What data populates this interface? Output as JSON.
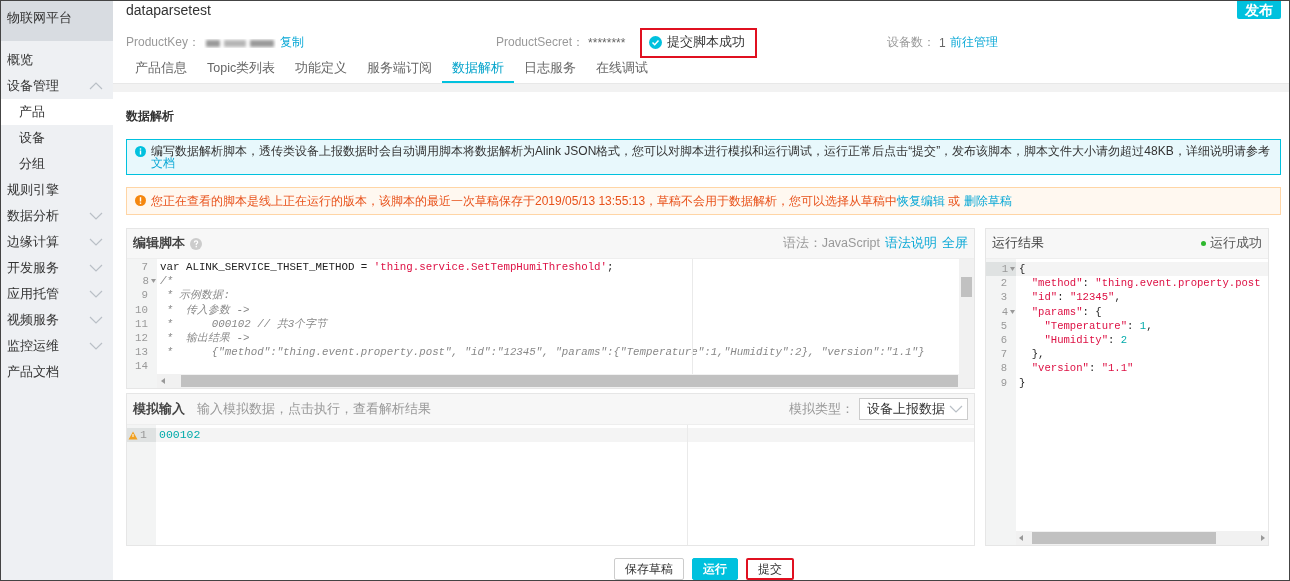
{
  "sidebar": {
    "title": "物联网平台",
    "items": [
      {
        "label": "概览",
        "kind": "link",
        "selected": false
      },
      {
        "label": "设备管理",
        "kind": "group",
        "expanded": true,
        "selected": false,
        "children": [
          {
            "label": "产品",
            "selected": true
          },
          {
            "label": "设备",
            "selected": false
          },
          {
            "label": "分组",
            "selected": false
          }
        ]
      },
      {
        "label": "规则引擎",
        "kind": "link",
        "selected": false
      },
      {
        "label": "数据分析",
        "kind": "group",
        "expanded": false,
        "selected": false
      },
      {
        "label": "边缘计算",
        "kind": "group",
        "expanded": false,
        "selected": false
      },
      {
        "label": "开发服务",
        "kind": "group",
        "expanded": false,
        "selected": false
      },
      {
        "label": "应用托管",
        "kind": "group",
        "expanded": false,
        "selected": false
      },
      {
        "label": "视频服务",
        "kind": "group",
        "expanded": false,
        "selected": false
      },
      {
        "label": "监控运维",
        "kind": "group",
        "expanded": false,
        "selected": false
      },
      {
        "label": "产品文档",
        "kind": "link",
        "selected": false
      }
    ]
  },
  "header": {
    "title": "dataparsetest",
    "publish_button": "发布",
    "product_key": {
      "label": "ProductKey：",
      "copy_link": "复制"
    },
    "product_secret": {
      "label": "ProductSecret：",
      "value": "********"
    },
    "toast": {
      "text": "提交脚本成功",
      "highlighted": true
    },
    "device_count": {
      "label": "设备数：",
      "value": "1",
      "link": "前往管理"
    },
    "tabs": [
      {
        "label": "产品信息",
        "selected": false
      },
      {
        "label": "Topic类列表",
        "selected": false
      },
      {
        "label": "功能定义",
        "selected": false
      },
      {
        "label": "服务端订阅",
        "selected": false
      },
      {
        "label": "数据解析",
        "selected": true
      },
      {
        "label": "日志服务",
        "selected": false
      },
      {
        "label": "在线调试",
        "selected": false
      }
    ]
  },
  "section_title": "数据解析",
  "info_alert": {
    "text": "编写数据解析脚本，透传类设备上报数据时会自动调用脚本将数据解析为Alink JSON格式，您可以对脚本进行模拟和运行调试，运行正常后点击“提交”，发布该脚本，脚本文件大小请勿超过48KB，详细说明请参考",
    "link": "文档"
  },
  "warning_alert": {
    "text": "您正在查看的脚本是线上正在运行的版本，该脚本的最近一次草稿保存于2019/05/13 13:55:13，草稿不会用于数据解析，您可以选择从草稿中",
    "link": "恢复编辑",
    "separator": "或",
    "link2": "删除草稿"
  },
  "script_editor": {
    "title": "编辑脚本",
    "syntax_label": "语法：JavaScript",
    "syntax_link": "语法说明",
    "fullscreen_link": "全屏",
    "lines": [
      {
        "number": "7",
        "foldable": false,
        "tokens": [
          {
            "kind": "plain",
            "text": "var ALINK_SERVICE_THSET_METHOD = "
          },
          {
            "kind": "string",
            "text": "'thing.service.SetTempHumiThreshold'"
          },
          {
            "kind": "plain",
            "text": ";"
          }
        ]
      },
      {
        "number": "8",
        "foldable": true,
        "tokens": [
          {
            "kind": "comment",
            "text": "/*"
          }
        ]
      },
      {
        "number": "9",
        "foldable": false,
        "tokens": [
          {
            "kind": "comment",
            "text": " * 示例数据:"
          }
        ]
      },
      {
        "number": "10",
        "foldable": false,
        "tokens": [
          {
            "kind": "comment",
            "text": " *  传入参数 ->"
          }
        ]
      },
      {
        "number": "11",
        "foldable": false,
        "tokens": [
          {
            "kind": "comment",
            "text": " *      000102 // 共3个字节"
          }
        ]
      },
      {
        "number": "12",
        "foldable": false,
        "tokens": [
          {
            "kind": "comment",
            "text": " *  输出结果 ->"
          }
        ]
      },
      {
        "number": "13",
        "foldable": false,
        "tokens": [
          {
            "kind": "comment",
            "text": " *      {\"method\":\"thing.event.property.post\", \"id\":\"12345\", \"params\":{\"Temperature\":1,\"Humidity\":2}, \"version\":\"1.1\"}"
          }
        ]
      },
      {
        "number": "14",
        "foldable": false
      }
    ]
  },
  "sim_input": {
    "title": "模拟输入",
    "hint": "输入模拟数据，点击执行，查看解析结果",
    "type_label": "模拟类型：",
    "type_value": "设备上报数据",
    "lines": [
      {
        "number": "1",
        "warning": true,
        "active": true,
        "tokens": [
          {
            "kind": "number",
            "text": "000102"
          }
        ]
      }
    ]
  },
  "result": {
    "title": "运行结果",
    "status": "运行成功",
    "lines": [
      {
        "number": "1",
        "foldable": true,
        "active": true,
        "tokens": [
          {
            "kind": "plain",
            "text": "{"
          }
        ]
      },
      {
        "number": "2",
        "foldable": false,
        "active": false,
        "tokens": [
          {
            "kind": "string",
            "text": "  \"method\""
          },
          {
            "kind": "plain",
            "text": ": "
          },
          {
            "kind": "string",
            "text": "\"thing.event.property.post"
          }
        ]
      },
      {
        "number": "3",
        "foldable": false,
        "active": false,
        "tokens": [
          {
            "kind": "string",
            "text": "  \"id\""
          },
          {
            "kind": "plain",
            "text": ": "
          },
          {
            "kind": "string",
            "text": "\"12345\""
          },
          {
            "kind": "plain",
            "text": ","
          }
        ]
      },
      {
        "number": "4",
        "foldable": true,
        "active": false,
        "tokens": [
          {
            "kind": "string",
            "text": "  \"params\""
          },
          {
            "kind": "plain",
            "text": ": {"
          }
        ]
      },
      {
        "number": "5",
        "foldable": false,
        "active": false,
        "tokens": [
          {
            "kind": "string",
            "text": "    \"Temperature\""
          },
          {
            "kind": "plain",
            "text": ": "
          },
          {
            "kind": "number",
            "text": "1"
          },
          {
            "kind": "plain",
            "text": ","
          }
        ]
      },
      {
        "number": "6",
        "foldable": false,
        "active": false,
        "tokens": [
          {
            "kind": "string",
            "text": "    \"Humidity\""
          },
          {
            "kind": "plain",
            "text": ": "
          },
          {
            "kind": "number",
            "text": "2"
          }
        ]
      },
      {
        "number": "7",
        "foldable": false,
        "active": false,
        "tokens": [
          {
            "kind": "plain",
            "text": "  },"
          }
        ]
      },
      {
        "number": "8",
        "foldable": false,
        "active": false,
        "tokens": [
          {
            "kind": "string",
            "text": "  \"version\""
          },
          {
            "kind": "plain",
            "text": ": "
          },
          {
            "kind": "string",
            "text": "\"1.1\""
          }
        ]
      },
      {
        "number": "9",
        "foldable": false,
        "active": false,
        "tokens": [
          {
            "kind": "plain",
            "text": "}"
          }
        ]
      }
    ]
  },
  "buttons": [
    {
      "label": "保存草稿",
      "kind": "default",
      "highlighted": false
    },
    {
      "label": "运行",
      "kind": "primary",
      "highlighted": false
    },
    {
      "label": "提交",
      "kind": "default",
      "highlighted": true
    }
  ]
}
